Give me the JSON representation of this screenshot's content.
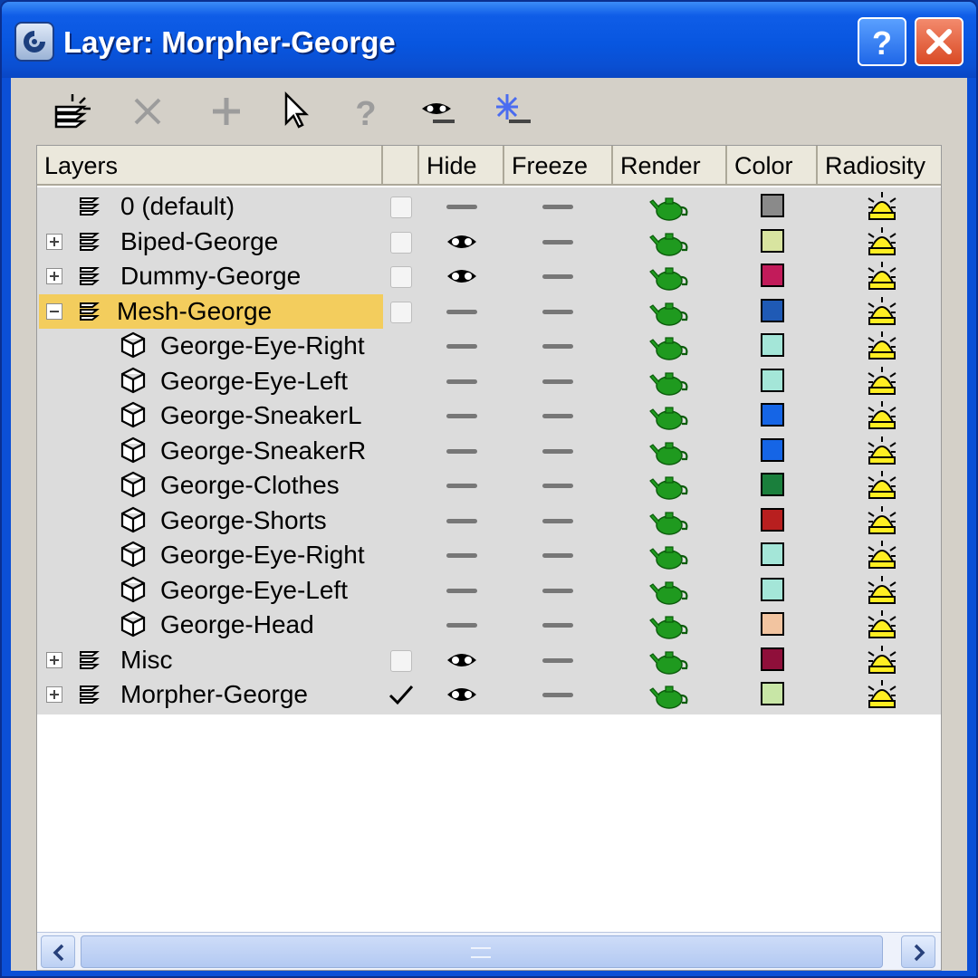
{
  "window": {
    "title": "Layer: Morpher-George",
    "help_label": "?",
    "close_label": "✕"
  },
  "toolbar": {
    "tools": [
      {
        "name": "create-layer-icon",
        "enabled": true
      },
      {
        "name": "delete-icon",
        "enabled": false
      },
      {
        "name": "add-icon",
        "enabled": false
      },
      {
        "name": "select-icon",
        "enabled": true
      },
      {
        "name": "help-icon",
        "enabled": false
      },
      {
        "name": "hide-toggle-icon",
        "enabled": true
      },
      {
        "name": "freeze-toggle-icon",
        "enabled": true
      }
    ]
  },
  "columns": {
    "layers": "Layers",
    "current": "",
    "hide": "Hide",
    "freeze": "Freeze",
    "render": "Render",
    "color": "Color",
    "radiosity": "Radiosity"
  },
  "rows": [
    {
      "name": "0 (default)",
      "type": "layer",
      "level": 0,
      "expander": "none",
      "current": false,
      "hidden": false,
      "frozen": false,
      "color": "#8a8a8a",
      "selected": false
    },
    {
      "name": "Biped-George",
      "type": "layer",
      "level": 0,
      "expander": "plus",
      "current": false,
      "hidden": true,
      "frozen": false,
      "color": "#d8e4a0",
      "selected": false
    },
    {
      "name": "Dummy-George",
      "type": "layer",
      "level": 0,
      "expander": "plus",
      "current": false,
      "hidden": true,
      "frozen": false,
      "color": "#c21b5a",
      "selected": false
    },
    {
      "name": "Mesh-George",
      "type": "layer",
      "level": 0,
      "expander": "minus",
      "current": false,
      "hidden": false,
      "frozen": false,
      "color": "#1f5ab5",
      "selected": true
    },
    {
      "name": "George-Eye-Right",
      "type": "object",
      "level": 1,
      "expander": "none",
      "hidden": false,
      "frozen": false,
      "color": "#a4e6d8",
      "selected": false
    },
    {
      "name": "George-Eye-Left",
      "type": "object",
      "level": 1,
      "expander": "none",
      "hidden": false,
      "frozen": false,
      "color": "#a4e6d8",
      "selected": false
    },
    {
      "name": "George-SneakerL",
      "type": "object",
      "level": 1,
      "expander": "none",
      "hidden": false,
      "frozen": false,
      "color": "#1565e6",
      "selected": false
    },
    {
      "name": "George-SneakerR",
      "type": "object",
      "level": 1,
      "expander": "none",
      "hidden": false,
      "frozen": false,
      "color": "#1565e6",
      "selected": false
    },
    {
      "name": "George-Clothes",
      "type": "object",
      "level": 1,
      "expander": "none",
      "hidden": false,
      "frozen": false,
      "color": "#1a7f3c",
      "selected": false
    },
    {
      "name": "George-Shorts",
      "type": "object",
      "level": 1,
      "expander": "none",
      "hidden": false,
      "frozen": false,
      "color": "#b81f1f",
      "selected": false
    },
    {
      "name": "George-Eye-Right",
      "type": "object",
      "level": 1,
      "expander": "none",
      "hidden": false,
      "frozen": false,
      "color": "#a4e6d8",
      "selected": false
    },
    {
      "name": "George-Eye-Left",
      "type": "object",
      "level": 1,
      "expander": "none",
      "hidden": false,
      "frozen": false,
      "color": "#a4e6d8",
      "selected": false
    },
    {
      "name": "George-Head",
      "type": "object",
      "level": 1,
      "expander": "none",
      "hidden": false,
      "frozen": false,
      "color": "#f2c4a0",
      "selected": false
    },
    {
      "name": "Misc",
      "type": "layer",
      "level": 0,
      "expander": "plus",
      "current": false,
      "hidden": true,
      "frozen": false,
      "color": "#8f0f3a",
      "selected": false
    },
    {
      "name": "Morpher-George",
      "type": "layer",
      "level": 0,
      "expander": "plus",
      "current": true,
      "hidden": true,
      "frozen": false,
      "color": "#c8e6a6",
      "selected": false
    }
  ]
}
